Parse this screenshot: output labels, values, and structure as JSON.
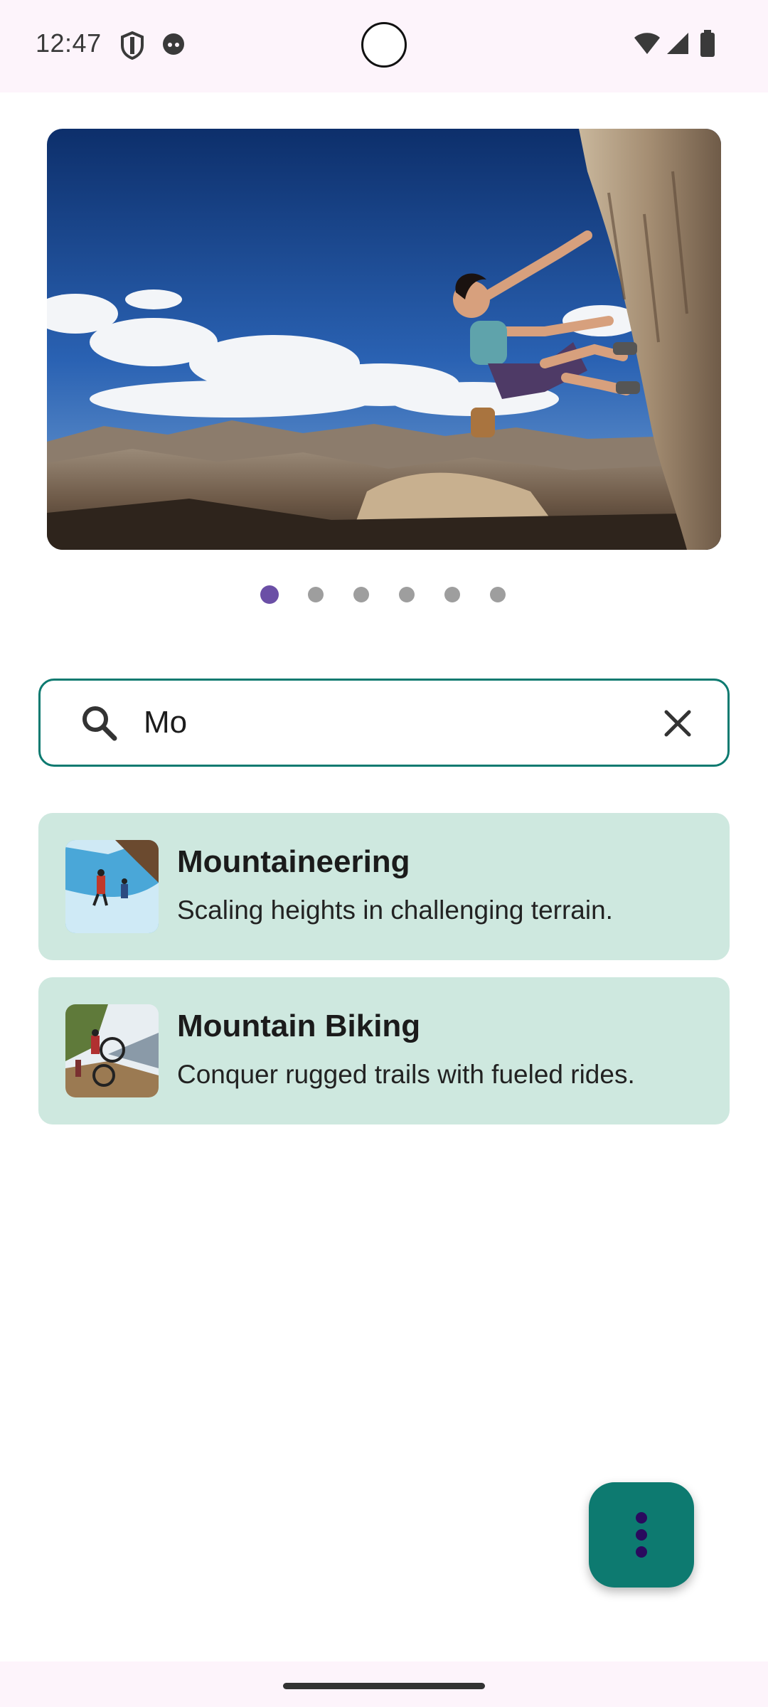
{
  "status_bar": {
    "time": "12:47"
  },
  "carousel": {
    "page_count": 6,
    "active_index": 0
  },
  "search": {
    "value": "Mo",
    "placeholder": ""
  },
  "results": [
    {
      "title": "Mountaineering",
      "description": "Scaling heights in challenging terrain."
    },
    {
      "title": "Mountain Biking",
      "description": "Conquer rugged trails with fueled rides."
    }
  ],
  "colors": {
    "accent": "#0d7a70",
    "card_bg": "#cee8df",
    "dot_active": "#6b4fa6",
    "dot_inactive": "#9e9e9e",
    "fab_icon": "#2a0a5e"
  },
  "icons": [
    "shield-icon",
    "face-icon",
    "wifi-icon",
    "signal-icon",
    "battery-icon",
    "search-icon",
    "close-icon",
    "more-vertical-icon"
  ]
}
